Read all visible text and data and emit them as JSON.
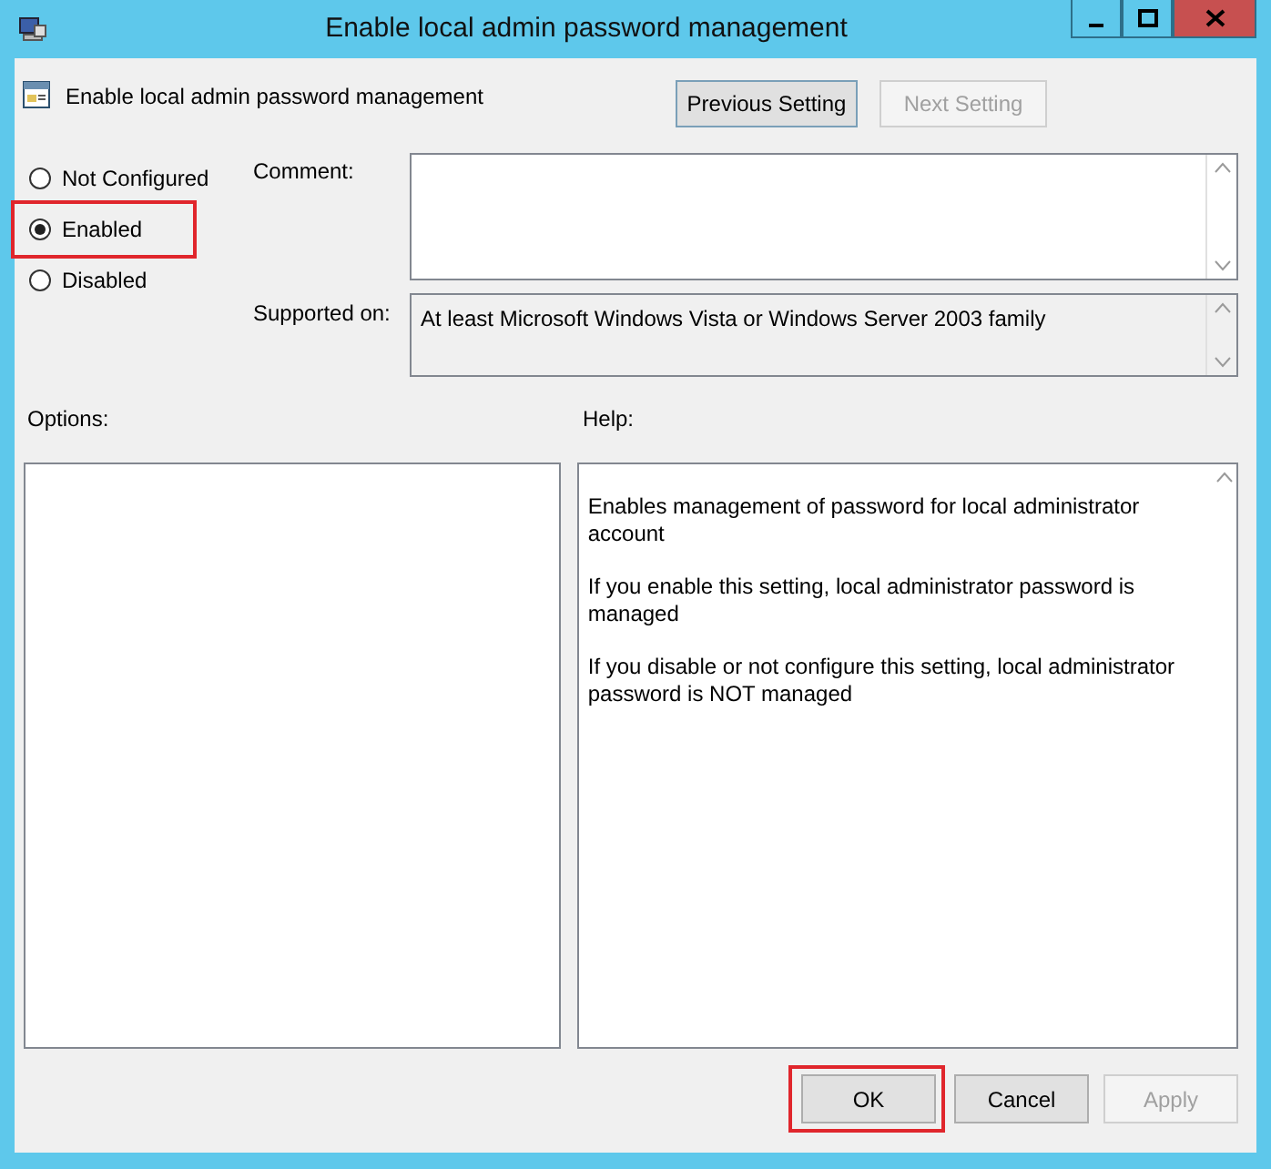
{
  "window": {
    "title": "Enable local admin password management"
  },
  "setting": {
    "name": "Enable local admin password management"
  },
  "nav_buttons": [
    {
      "label": "Previous Setting",
      "disabled": false
    },
    {
      "label": "Next Setting",
      "disabled": true
    }
  ],
  "state_options": [
    {
      "label": "Not Configured",
      "selected": false,
      "highlighted": false
    },
    {
      "label": "Enabled",
      "selected": true,
      "highlighted": true
    },
    {
      "label": "Disabled",
      "selected": false,
      "highlighted": false
    }
  ],
  "comment": {
    "label": "Comment:"
  },
  "supported_on": {
    "label": "Supported on:",
    "value": "At least Microsoft Windows Vista or Windows Server 2003 family"
  },
  "options": {
    "label": "Options:"
  },
  "help": {
    "label": "Help:",
    "paragraphs": [
      "Enables management of password for local administrator account",
      "If you enable this setting, local administrator password is managed",
      "If you disable or not configure this setting, local administrator password is NOT managed"
    ]
  },
  "buttons": [
    {
      "label": "OK",
      "disabled": false,
      "highlighted": true
    },
    {
      "label": "Cancel",
      "disabled": false,
      "highlighted": false
    },
    {
      "label": "Apply",
      "disabled": true,
      "highlighted": false
    }
  ]
}
